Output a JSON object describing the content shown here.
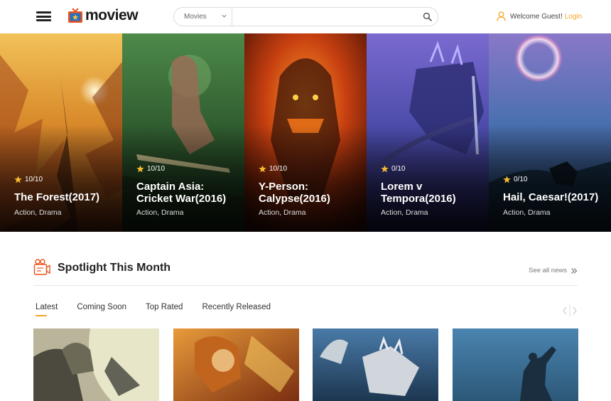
{
  "header": {
    "logo_text": "moview",
    "search": {
      "category": "Movies",
      "placeholder": ""
    },
    "welcome_text": "Welcome Guest!",
    "login_label": "Login"
  },
  "hero": {
    "cards": [
      {
        "rating": "10/10",
        "title_line1": "The Forest(2017)",
        "title_line2": "",
        "genre": "Action, Drama"
      },
      {
        "rating": "10/10",
        "title_line1": "Captain Asia:",
        "title_line2": "Cricket War(2016)",
        "genre": "Action, Drama"
      },
      {
        "rating": "10/10",
        "title_line1": "Y-Person:",
        "title_line2": "Calypse(2016)",
        "genre": "Action, Drama"
      },
      {
        "rating": "0/10",
        "title_line1": "Lorem v",
        "title_line2": "Tempora(2016)",
        "genre": "Action, Drama"
      },
      {
        "rating": "0/10",
        "title_line1": "Hail, Caesar!(2017)",
        "title_line2": "",
        "genre": "Action, Drama"
      }
    ]
  },
  "spotlight": {
    "title": "Spotlight This Month",
    "see_all": "See all news",
    "tabs": [
      {
        "label": "Latest"
      },
      {
        "label": "Coming Soon"
      },
      {
        "label": "Top Rated"
      },
      {
        "label": "Recently Released"
      }
    ]
  },
  "colors": {
    "accent": "#f5a623",
    "text_dark": "#222222",
    "border": "#dcdcdc"
  },
  "icons": {
    "menu": "hamburger-icon",
    "search": "search-icon",
    "user": "user-icon",
    "rating": "star-icon",
    "spotlight": "film-camera-icon",
    "see_all": "double-chevron-right-icon"
  }
}
